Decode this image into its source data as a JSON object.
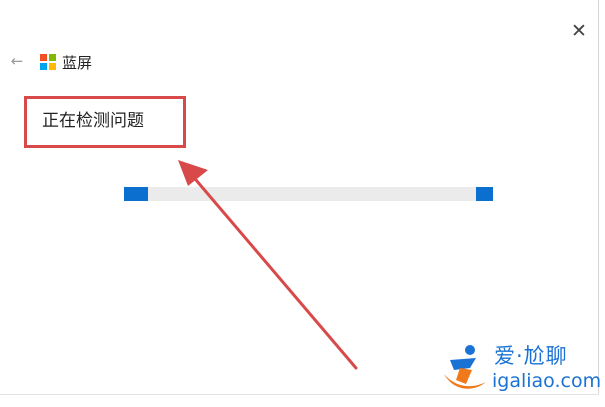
{
  "window": {
    "app_title": "蓝屏",
    "status_text": "正在检测问题",
    "close_icon": "close-icon",
    "back_icon": "back-arrow-icon"
  },
  "app_logo_colors": [
    "#f25022",
    "#7fba00",
    "#00a4ef",
    "#ffb900"
  ],
  "progress": {
    "indeterminate": true,
    "accent_color": "#0a6fcf",
    "track_color": "#ebebeb"
  },
  "annotation": {
    "highlight_color": "#d84a4a"
  },
  "watermark": {
    "line1": "爱·尬聊",
    "line2": "igaliao.com"
  }
}
